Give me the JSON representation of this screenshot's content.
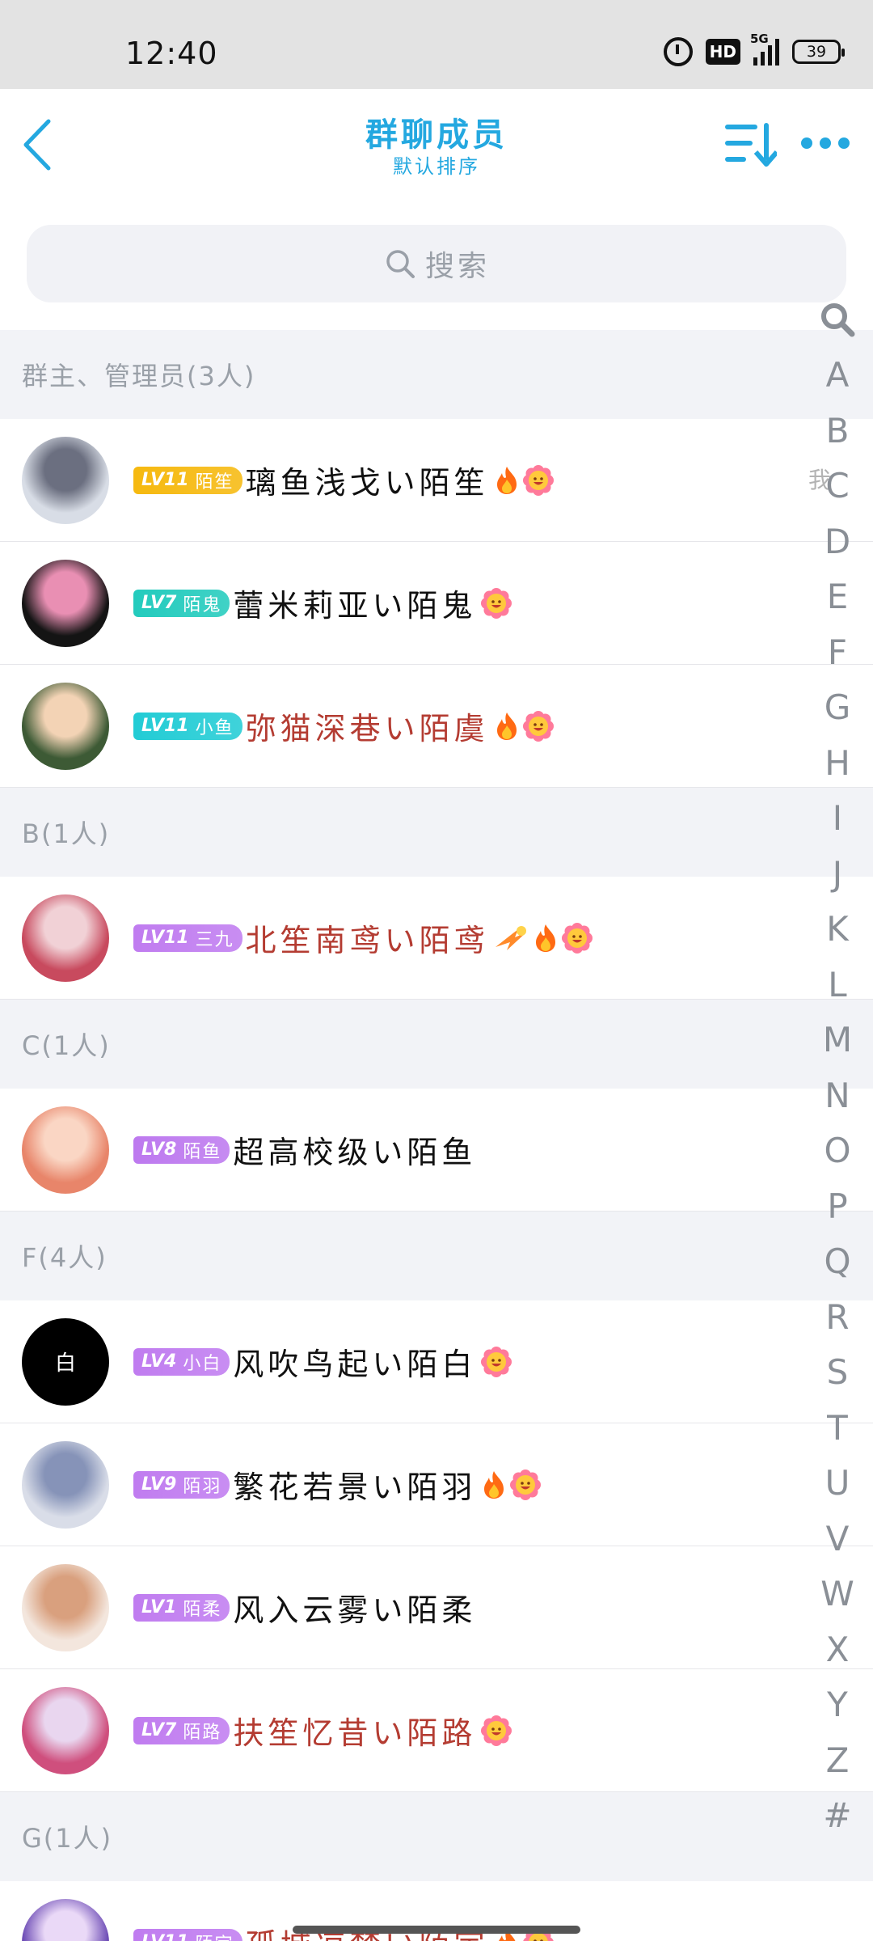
{
  "status_bar": {
    "time": "12:40",
    "network": "5G",
    "hd": "HD",
    "battery": "39"
  },
  "header": {
    "title": "群聊成员",
    "subtitle": "默认排序",
    "icons": [
      "chevron-left-icon",
      "sort-icon",
      "more-icon"
    ],
    "accent_color": "#24a8e0"
  },
  "search": {
    "placeholder": "搜索"
  },
  "sections": [
    {
      "title": "群主、管理员(3人)",
      "members": [
        {
          "level": "LV11",
          "tag": "陌笙",
          "badge_color": "#f6b90f",
          "name": "璃鱼浅戈い陌笙",
          "name_color": "black",
          "fire": true,
          "smile": true,
          "me": "我"
        },
        {
          "level": "LV7",
          "tag": "陌鬼",
          "badge_color": "#23cbbd",
          "name": "蕾米莉亚い陌鬼",
          "name_color": "black",
          "fire": false,
          "smile": true
        },
        {
          "level": "LV11",
          "tag": "小鱼",
          "badge_color": "#22ccd5",
          "name": "弥猫深巷い陌虞",
          "name_color": "red",
          "fire": true,
          "smile": true
        }
      ]
    },
    {
      "title": "B(1人)",
      "members": [
        {
          "level": "LV11",
          "tag": "三九",
          "badge_color": "#c07cf0",
          "name": "北笙南鸢い陌鸢",
          "name_color": "red",
          "comet": true,
          "fire": true,
          "smile": true
        }
      ]
    },
    {
      "title": "C(1人)",
      "members": [
        {
          "level": "LV8",
          "tag": "陌鱼",
          "badge_color": "#bd79ef",
          "name": "超高校级い陌鱼",
          "name_color": "black",
          "fire": false,
          "smile": false
        }
      ]
    },
    {
      "title": "F(4人)",
      "members": [
        {
          "level": "LV4",
          "tag": "小白",
          "badge_color": "#c07cf0",
          "name": "风吹鸟起い陌白",
          "name_color": "black",
          "fire": false,
          "smile": true,
          "avatar_text": "白"
        },
        {
          "level": "LV9",
          "tag": "陌羽",
          "badge_color": "#c07cf0",
          "name": "繁花若景い陌羽",
          "name_color": "black",
          "fire": true,
          "smile": true
        },
        {
          "level": "LV1",
          "tag": "陌柔",
          "badge_color": "#c07cf0",
          "name": "风入云雾い陌柔",
          "name_color": "black",
          "fire": false,
          "smile": false
        },
        {
          "level": "LV7",
          "tag": "陌路",
          "badge_color": "#c07cf0",
          "name": "扶笙忆昔い陌路",
          "name_color": "red",
          "fire": false,
          "smile": true
        }
      ]
    },
    {
      "title": "G(1人)",
      "members": [
        {
          "level": "LV11",
          "tag": "陌宇",
          "badge_color": "#c07cf0",
          "name": "孤城凉梦い陌宇",
          "name_color": "red",
          "fire": true,
          "smile": true
        }
      ]
    }
  ],
  "index_letters": [
    "A",
    "B",
    "C",
    "D",
    "E",
    "F",
    "G",
    "H",
    "I",
    "J",
    "K",
    "L",
    "M",
    "N",
    "O",
    "P",
    "Q",
    "R",
    "S",
    "T",
    "U",
    "V",
    "W",
    "X",
    "Y",
    "Z",
    "#"
  ]
}
